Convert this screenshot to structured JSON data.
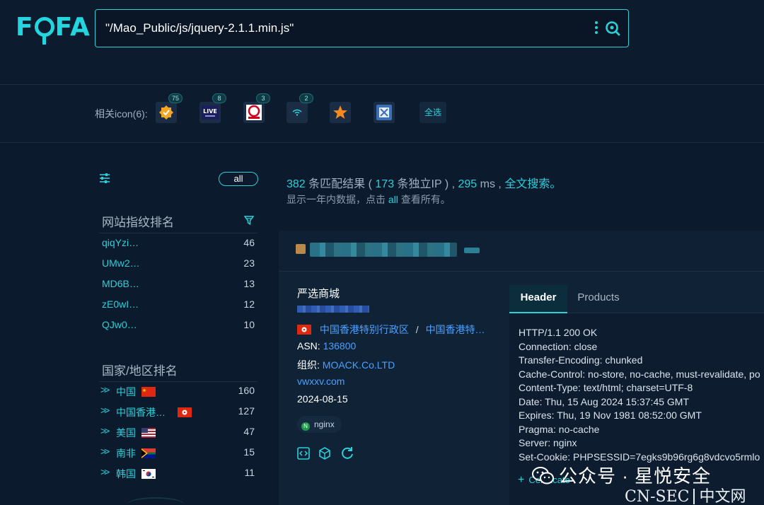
{
  "app": {
    "logo": "FOFA",
    "search_query": "\"/Mao_Public/js/jquery-2.1.1.min.js\""
  },
  "related": {
    "label": "相关icon(6):",
    "icons": [
      {
        "name": "badge-check-icon",
        "count": "75"
      },
      {
        "name": "live-icon",
        "count": "8"
      },
      {
        "name": "red-circle-logo-icon",
        "count": "3"
      },
      {
        "name": "wifi-small-icon",
        "count": "2"
      },
      {
        "name": "star-icon",
        "count": ""
      },
      {
        "name": "blue-square-app-icon",
        "count": ""
      }
    ],
    "select_all": "全选"
  },
  "sidebar": {
    "all_label": "all",
    "fingerprint_title": "网站指纹排名",
    "fingerprints": [
      {
        "name": "qiqYzi…",
        "count": "46"
      },
      {
        "name": "UMw2…",
        "count": "23"
      },
      {
        "name": "MD6B…",
        "count": "13"
      },
      {
        "name": "zE0wI…",
        "count": "12"
      },
      {
        "name": "QJw0…",
        "count": "10"
      }
    ],
    "country_title": "国家/地区排名",
    "countries": [
      {
        "name": "中国",
        "flag": "cn",
        "count": "160"
      },
      {
        "name": "中国香港…",
        "flag": "hk",
        "count": "127"
      },
      {
        "name": "美国",
        "flag": "us",
        "count": "47"
      },
      {
        "name": "南非",
        "flag": "za",
        "count": "15"
      },
      {
        "name": "韩国",
        "flag": "kr",
        "count": "11"
      }
    ]
  },
  "summary": {
    "match_count": "382",
    "match_text": "条匹配结果 (",
    "ip_count": "173",
    "ip_text": "条独立IP ) ,",
    "ms": "295",
    "ms_unit": "ms ,",
    "fulltext": "全文搜索。",
    "sub_prefix": "显示一年内数据，点击",
    "sub_all": "all",
    "sub_suffix": "查看所有。"
  },
  "result": {
    "title": "严选商城",
    "location_region": "中国香港特别行政区",
    "location_sep": "/",
    "location_city": "中国香港特…",
    "asn_label": "ASN:",
    "asn_value": "136800",
    "org_label": "组织:",
    "org_value": "MOACK.Co.LTD",
    "domain": "vwxxv.com",
    "date": "2024-08-15",
    "tag": "nginx",
    "tabs": [
      "Header",
      "Products"
    ],
    "headers": [
      "HTTP/1.1 200 OK",
      "Connection: close",
      "Transfer-Encoding: chunked",
      "Cache-Control: no-store, no-cache, must-revalidate, po",
      "Content-Type: text/html; charset=UTF-8",
      "Date: Thu, 15 Aug 2024 15:37:45 GMT",
      "Expires: Thu, 19 Nov 1981 08:52:00 GMT",
      "Pragma: no-cache",
      "Server: nginx",
      "Set-Cookie: PHPSESSID=7egks9b96rg6g8vdcvo5rmlo"
    ],
    "certificate": "Certificate"
  },
  "watermark": {
    "line1": "公众号 · 星悦安全",
    "line2_left": "CN-SEC",
    "line2_right": "中文网"
  },
  "colors": {
    "background": "#0b1a2c",
    "accent": "#2bd0d9",
    "link_blue": "#4aa0ff"
  }
}
